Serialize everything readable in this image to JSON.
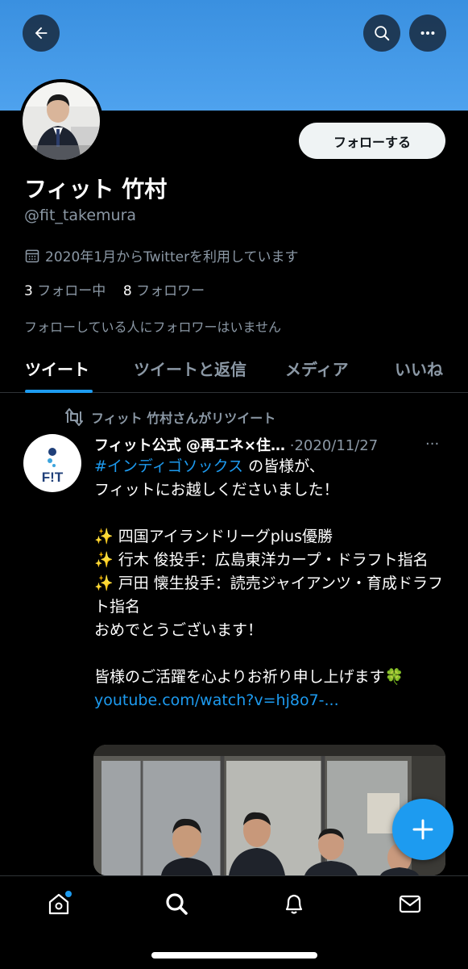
{
  "profile": {
    "name": "フィット 竹村",
    "handle": "@fit_takemura",
    "joined": "2020年1月からTwitterを利用しています",
    "following_count": "3",
    "following_label": "フォロー中",
    "followers_count": "8",
    "followers_label": "フォロワー",
    "followers_note": "フォローしている人にフォロワーはいません",
    "follow_button": "フォローする"
  },
  "tabs": [
    {
      "label": "ツイート",
      "active": true
    },
    {
      "label": "ツイートと返信",
      "active": false
    },
    {
      "label": "メディア",
      "active": false
    },
    {
      "label": "いいね",
      "active": false
    }
  ],
  "tweet": {
    "retweet_context": "フィット 竹村さんがリツイート",
    "author": "フィット公式 @再エネ×住…",
    "separator": "·",
    "date": "2020/11/27",
    "more": "···",
    "avatar_text": "F!T",
    "hashtag": "#インディゴソックス",
    "line1_rest": " の皆様が、",
    "line2": "フィットにお越しくださいました！",
    "line3": "✨ 四国アイランドリーグplus優勝",
    "line4": "✨ 行木 俊投手：広島東洋カープ・ドラフト指名",
    "line5": "✨ 戸田 懐生投手：読売ジャイアンツ・育成ドラフト指名",
    "line6": "おめでとうございます！",
    "line7": "皆様のご活躍を心よりお祈り申し上げます🍀",
    "link": "youtube.com/watch?v=hj8o7-..."
  },
  "icons": {
    "back": "back-arrow-icon",
    "search": "search-icon",
    "more": "more-icon",
    "calendar": "calendar-icon",
    "retweet": "retweet-icon",
    "compose": "plus-icon",
    "home": "home-icon",
    "explore": "search-icon",
    "notifications": "bell-icon",
    "messages": "mail-icon"
  },
  "colors": {
    "accent": "#1d9bf0",
    "banner": "#4a9df0",
    "muted": "#8b98a5"
  }
}
